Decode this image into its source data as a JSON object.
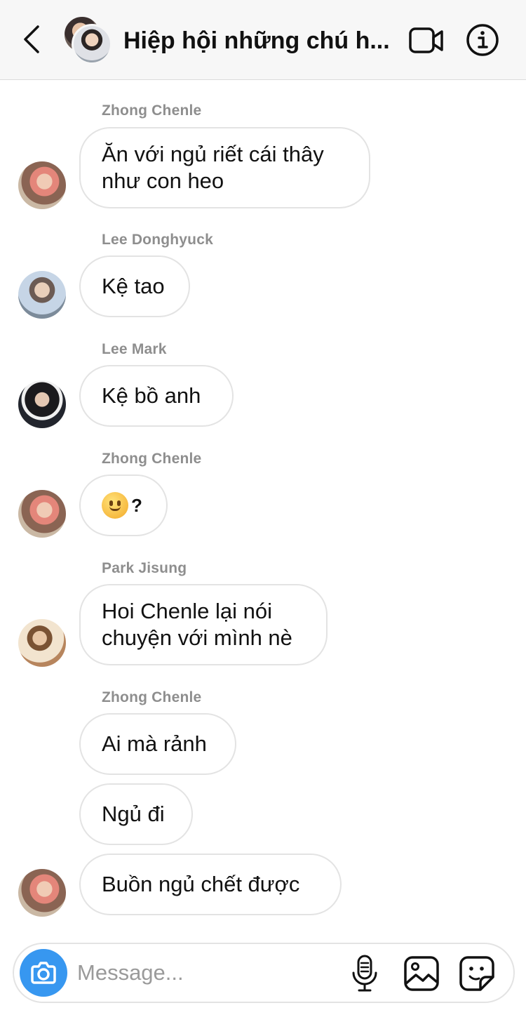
{
  "header": {
    "title": "Hiệp hội những chú h..."
  },
  "messages": [
    {
      "sender": "Zhong Chenle",
      "text": "Ăn với ngủ riết cái thây như con heo"
    },
    {
      "sender": "Lee Donghyuck",
      "text": "Kệ tao"
    },
    {
      "sender": "Lee Mark",
      "text": "Kệ bồ anh"
    },
    {
      "sender": "Zhong Chenle",
      "text": "?"
    },
    {
      "sender": "Park Jisung",
      "text": "Hoi Chenle lại nói chuyện với mình nè"
    },
    {
      "sender": "Zhong Chenle",
      "text": "Ai mà rảnh"
    },
    {
      "text": "Ngủ đi"
    },
    {
      "text": "Buồn ngủ chết được"
    }
  ],
  "composer": {
    "placeholder": "Message..."
  },
  "icons": {
    "back": "chevron-left-icon",
    "video": "video-camera-icon",
    "info": "info-icon",
    "camera": "camera-icon",
    "mic": "microphone-icon",
    "gallery": "image-icon",
    "sticker": "sticker-icon"
  },
  "colors": {
    "accent": "#3797f0",
    "bubble_border": "#e3e3e3",
    "sender_text": "#8e8e8e"
  }
}
